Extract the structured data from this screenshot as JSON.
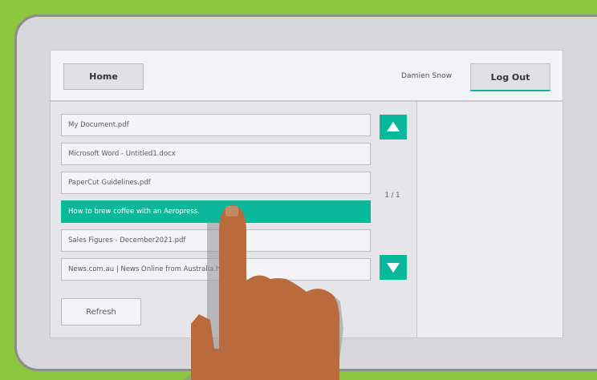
{
  "header": {
    "home_label": "Home",
    "user_name": "Damien Snow",
    "logout_label": "Log Out"
  },
  "files": [
    {
      "name": "My Document.pdf",
      "selected": false
    },
    {
      "name": "Microsoft Word - Untitled1.docx",
      "selected": false
    },
    {
      "name": "PaperCut Guidelines.pdf",
      "selected": false
    },
    {
      "name": "How to brew coffee with an Aeropress.",
      "selected": true
    },
    {
      "name": "Sales Figures - December2021.pdf",
      "selected": false
    },
    {
      "name": "News.com.au | News Online from Australia.ht",
      "selected": false
    }
  ],
  "pager": {
    "page_text": "1 / 1"
  },
  "actions": {
    "refresh_label": "Refresh"
  },
  "icons": {
    "scroll_up": "up-arrow-icon",
    "scroll_down": "down-arrow-icon",
    "pointer": "pointing-hand-icon"
  },
  "colors": {
    "accent": "#0bb79b",
    "background": "#8cc63f",
    "hand": "#b96b3d"
  }
}
